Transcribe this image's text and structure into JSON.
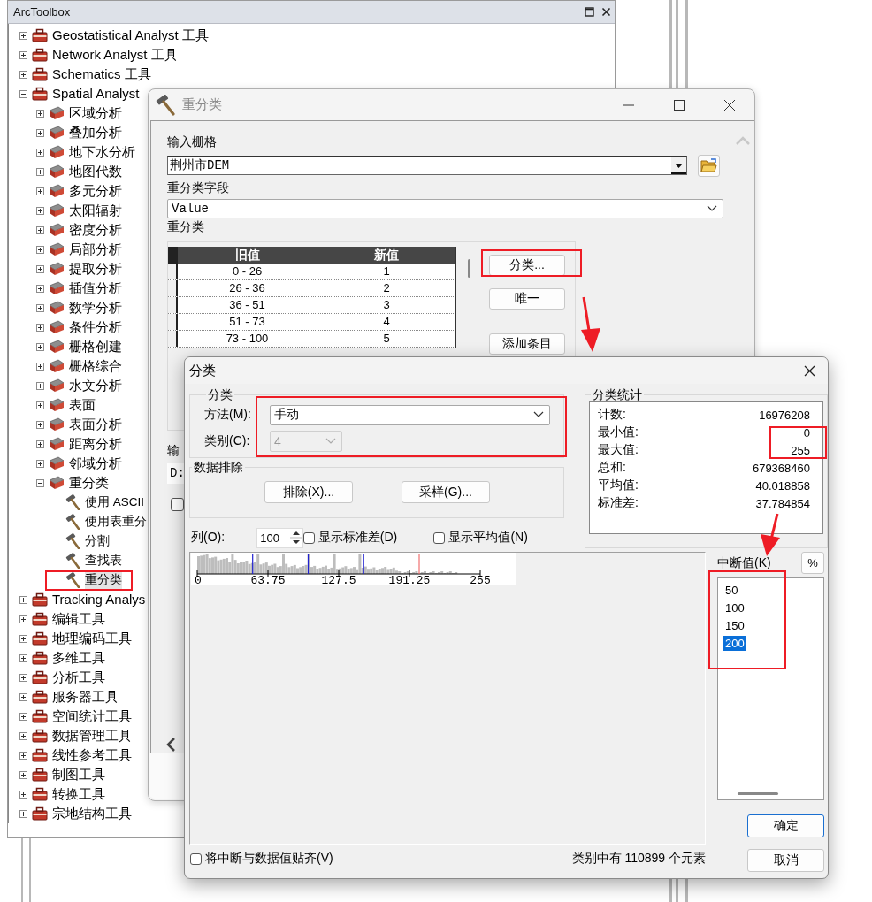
{
  "toolbox": {
    "title": "ArcToolbox",
    "tree": [
      {
        "label": "Geostatistical Analyst 工具",
        "kind": "toolbox",
        "expanded": false,
        "selected": false
      },
      {
        "label": "Network Analyst 工具",
        "kind": "toolbox",
        "expanded": false,
        "selected": false
      },
      {
        "label": "Schematics 工具",
        "kind": "toolbox",
        "expanded": false,
        "selected": false
      },
      {
        "label": "Spatial Analyst",
        "kind": "toolbox",
        "expanded": true,
        "selected": false,
        "children": [
          {
            "label": "区域分析",
            "kind": "toolset",
            "expanded": false,
            "selected": false
          },
          {
            "label": "叠加分析",
            "kind": "toolset",
            "expanded": false,
            "selected": false
          },
          {
            "label": "地下水分析",
            "kind": "toolset",
            "expanded": false,
            "selected": false
          },
          {
            "label": "地图代数",
            "kind": "toolset",
            "expanded": false,
            "selected": false
          },
          {
            "label": "多元分析",
            "kind": "toolset",
            "expanded": false,
            "selected": false
          },
          {
            "label": "太阳辐射",
            "kind": "toolset",
            "expanded": false,
            "selected": false
          },
          {
            "label": "密度分析",
            "kind": "toolset",
            "expanded": false,
            "selected": false
          },
          {
            "label": "局部分析",
            "kind": "toolset",
            "expanded": false,
            "selected": false
          },
          {
            "label": "提取分析",
            "kind": "toolset",
            "expanded": false,
            "selected": false
          },
          {
            "label": "插值分析",
            "kind": "toolset",
            "expanded": false,
            "selected": false
          },
          {
            "label": "数学分析",
            "kind": "toolset",
            "expanded": false,
            "selected": false
          },
          {
            "label": "条件分析",
            "kind": "toolset",
            "expanded": false,
            "selected": false
          },
          {
            "label": "栅格创建",
            "kind": "toolset",
            "expanded": false,
            "selected": false
          },
          {
            "label": "栅格综合",
            "kind": "toolset",
            "expanded": false,
            "selected": false
          },
          {
            "label": "水文分析",
            "kind": "toolset",
            "expanded": false,
            "selected": false
          },
          {
            "label": "表面",
            "kind": "toolset",
            "expanded": false,
            "selected": false
          },
          {
            "label": "表面分析",
            "kind": "toolset",
            "expanded": false,
            "selected": false
          },
          {
            "label": "距离分析",
            "kind": "toolset",
            "expanded": false,
            "selected": false
          },
          {
            "label": "邻域分析",
            "kind": "toolset",
            "expanded": false,
            "selected": false
          },
          {
            "label": "重分类",
            "kind": "toolset",
            "expanded": true,
            "selected": false,
            "children": [
              {
                "label": "使用 ASCII",
                "kind": "tool",
                "selected": false
              },
              {
                "label": "使用表重分",
                "kind": "tool",
                "selected": false
              },
              {
                "label": "分割",
                "kind": "tool",
                "selected": false
              },
              {
                "label": "查找表",
                "kind": "tool",
                "selected": false
              },
              {
                "label": "重分类",
                "kind": "tool",
                "selected": true
              }
            ]
          }
        ]
      },
      {
        "label": "Tracking Analys",
        "kind": "toolbox",
        "expanded": false,
        "selected": false
      },
      {
        "label": "编辑工具",
        "kind": "toolbox",
        "expanded": false,
        "selected": false
      },
      {
        "label": "地理编码工具",
        "kind": "toolbox",
        "expanded": false,
        "selected": false
      },
      {
        "label": "多维工具",
        "kind": "toolbox",
        "expanded": false,
        "selected": false
      },
      {
        "label": "分析工具",
        "kind": "toolbox",
        "expanded": false,
        "selected": false
      },
      {
        "label": "服务器工具",
        "kind": "toolbox",
        "expanded": false,
        "selected": false
      },
      {
        "label": "空间统计工具",
        "kind": "toolbox",
        "expanded": false,
        "selected": false
      },
      {
        "label": "数据管理工具",
        "kind": "toolbox",
        "expanded": false,
        "selected": false
      },
      {
        "label": "线性参考工具",
        "kind": "toolbox",
        "expanded": false,
        "selected": false
      },
      {
        "label": "制图工具",
        "kind": "toolbox",
        "expanded": false,
        "selected": false
      },
      {
        "label": "转换工具",
        "kind": "toolbox",
        "expanded": false,
        "selected": false
      },
      {
        "label": "宗地结构工具",
        "kind": "toolbox",
        "expanded": false,
        "selected": false
      }
    ]
  },
  "reclass_window": {
    "title": "重分类",
    "input_raster_label": "输入栅格",
    "input_raster": "荆州市DEM",
    "field_label": "重分类字段",
    "field": "Value",
    "table_label": "重分类",
    "columns": [
      "旧值",
      "新值"
    ],
    "rows": [
      {
        "old": "0 - 26",
        "new": "1"
      },
      {
        "old": "26 - 36",
        "new": "2"
      },
      {
        "old": "36 - 51",
        "new": "3"
      },
      {
        "old": "51 - 73",
        "new": "4"
      },
      {
        "old": "73 - 100",
        "new": "5"
      }
    ],
    "buttons": [
      "分类...",
      "唯一",
      "添加条目"
    ],
    "output_label": "输",
    "output_field": "D:",
    "option_checkbox": {
      "checked": false
    }
  },
  "classify_dialog": {
    "title": "分类",
    "classification_group": "分类",
    "method_label": "方法(M):",
    "method": "手动",
    "classes_label": "类别(C):",
    "classes": {
      "value": "4",
      "disabled": true
    },
    "exclusion_group": "数据排除",
    "exclusion_buttons": [
      "排除(X)...",
      "采样(G)..."
    ],
    "statistics_group": "分类统计",
    "statistics": [
      {
        "label": "计数:",
        "value": "16976208"
      },
      {
        "label": "最小值:",
        "value": "0"
      },
      {
        "label": "最大值:",
        "value": "255"
      },
      {
        "label": "总和:",
        "value": "679368460"
      },
      {
        "label": "平均值:",
        "value": "40.018858"
      },
      {
        "label": "标准差:",
        "value": "37.784854"
      }
    ],
    "columns_label": "列(O):",
    "columns_value": "100",
    "options": [
      {
        "label": "显示标准差(D)",
        "checked": false
      },
      {
        "label": "显示平均值(N)",
        "checked": false
      }
    ],
    "histogram": {
      "ticks": [
        "0",
        "63.75",
        "127.5",
        "191.25",
        "255"
      ]
    },
    "breaks_label": "中断值(K)",
    "percent_button": "%",
    "breaks": [
      {
        "value": "50",
        "selected": false
      },
      {
        "value": "100",
        "selected": false
      },
      {
        "value": "150",
        "selected": false
      },
      {
        "value": "200",
        "selected": true
      }
    ],
    "snap": {
      "label": "将中断与数据值贴齐(V)",
      "checked": false
    },
    "status": "类别中有 110899 个元素",
    "buttons": [
      {
        "label": "确定",
        "default": true
      },
      {
        "label": "取消",
        "default": false
      }
    ]
  }
}
